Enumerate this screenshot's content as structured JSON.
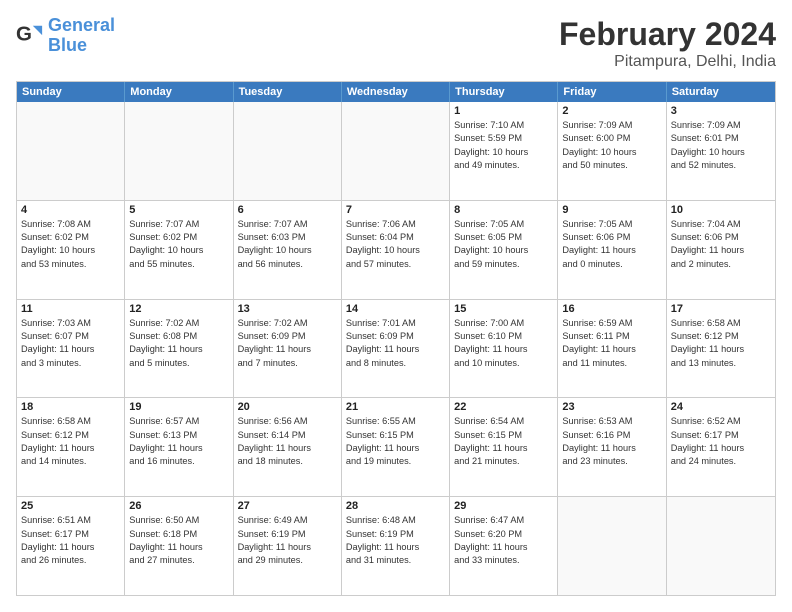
{
  "logo": {
    "text_general": "General",
    "text_blue": "Blue"
  },
  "title": "February 2024",
  "subtitle": "Pitampura, Delhi, India",
  "headers": [
    "Sunday",
    "Monday",
    "Tuesday",
    "Wednesday",
    "Thursday",
    "Friday",
    "Saturday"
  ],
  "rows": [
    [
      {
        "day": "",
        "info": "",
        "empty": true
      },
      {
        "day": "",
        "info": "",
        "empty": true
      },
      {
        "day": "",
        "info": "",
        "empty": true
      },
      {
        "day": "",
        "info": "",
        "empty": true
      },
      {
        "day": "1",
        "info": "Sunrise: 7:10 AM\nSunset: 5:59 PM\nDaylight: 10 hours\nand 49 minutes."
      },
      {
        "day": "2",
        "info": "Sunrise: 7:09 AM\nSunset: 6:00 PM\nDaylight: 10 hours\nand 50 minutes."
      },
      {
        "day": "3",
        "info": "Sunrise: 7:09 AM\nSunset: 6:01 PM\nDaylight: 10 hours\nand 52 minutes."
      }
    ],
    [
      {
        "day": "4",
        "info": "Sunrise: 7:08 AM\nSunset: 6:02 PM\nDaylight: 10 hours\nand 53 minutes."
      },
      {
        "day": "5",
        "info": "Sunrise: 7:07 AM\nSunset: 6:02 PM\nDaylight: 10 hours\nand 55 minutes."
      },
      {
        "day": "6",
        "info": "Sunrise: 7:07 AM\nSunset: 6:03 PM\nDaylight: 10 hours\nand 56 minutes."
      },
      {
        "day": "7",
        "info": "Sunrise: 7:06 AM\nSunset: 6:04 PM\nDaylight: 10 hours\nand 57 minutes."
      },
      {
        "day": "8",
        "info": "Sunrise: 7:05 AM\nSunset: 6:05 PM\nDaylight: 10 hours\nand 59 minutes."
      },
      {
        "day": "9",
        "info": "Sunrise: 7:05 AM\nSunset: 6:06 PM\nDaylight: 11 hours\nand 0 minutes."
      },
      {
        "day": "10",
        "info": "Sunrise: 7:04 AM\nSunset: 6:06 PM\nDaylight: 11 hours\nand 2 minutes."
      }
    ],
    [
      {
        "day": "11",
        "info": "Sunrise: 7:03 AM\nSunset: 6:07 PM\nDaylight: 11 hours\nand 3 minutes."
      },
      {
        "day": "12",
        "info": "Sunrise: 7:02 AM\nSunset: 6:08 PM\nDaylight: 11 hours\nand 5 minutes."
      },
      {
        "day": "13",
        "info": "Sunrise: 7:02 AM\nSunset: 6:09 PM\nDaylight: 11 hours\nand 7 minutes."
      },
      {
        "day": "14",
        "info": "Sunrise: 7:01 AM\nSunset: 6:09 PM\nDaylight: 11 hours\nand 8 minutes."
      },
      {
        "day": "15",
        "info": "Sunrise: 7:00 AM\nSunset: 6:10 PM\nDaylight: 11 hours\nand 10 minutes."
      },
      {
        "day": "16",
        "info": "Sunrise: 6:59 AM\nSunset: 6:11 PM\nDaylight: 11 hours\nand 11 minutes."
      },
      {
        "day": "17",
        "info": "Sunrise: 6:58 AM\nSunset: 6:12 PM\nDaylight: 11 hours\nand 13 minutes."
      }
    ],
    [
      {
        "day": "18",
        "info": "Sunrise: 6:58 AM\nSunset: 6:12 PM\nDaylight: 11 hours\nand 14 minutes."
      },
      {
        "day": "19",
        "info": "Sunrise: 6:57 AM\nSunset: 6:13 PM\nDaylight: 11 hours\nand 16 minutes."
      },
      {
        "day": "20",
        "info": "Sunrise: 6:56 AM\nSunset: 6:14 PM\nDaylight: 11 hours\nand 18 minutes."
      },
      {
        "day": "21",
        "info": "Sunrise: 6:55 AM\nSunset: 6:15 PM\nDaylight: 11 hours\nand 19 minutes."
      },
      {
        "day": "22",
        "info": "Sunrise: 6:54 AM\nSunset: 6:15 PM\nDaylight: 11 hours\nand 21 minutes."
      },
      {
        "day": "23",
        "info": "Sunrise: 6:53 AM\nSunset: 6:16 PM\nDaylight: 11 hours\nand 23 minutes."
      },
      {
        "day": "24",
        "info": "Sunrise: 6:52 AM\nSunset: 6:17 PM\nDaylight: 11 hours\nand 24 minutes."
      }
    ],
    [
      {
        "day": "25",
        "info": "Sunrise: 6:51 AM\nSunset: 6:17 PM\nDaylight: 11 hours\nand 26 minutes."
      },
      {
        "day": "26",
        "info": "Sunrise: 6:50 AM\nSunset: 6:18 PM\nDaylight: 11 hours\nand 27 minutes."
      },
      {
        "day": "27",
        "info": "Sunrise: 6:49 AM\nSunset: 6:19 PM\nDaylight: 11 hours\nand 29 minutes."
      },
      {
        "day": "28",
        "info": "Sunrise: 6:48 AM\nSunset: 6:19 PM\nDaylight: 11 hours\nand 31 minutes."
      },
      {
        "day": "29",
        "info": "Sunrise: 6:47 AM\nSunset: 6:20 PM\nDaylight: 11 hours\nand 33 minutes."
      },
      {
        "day": "",
        "info": "",
        "empty": true
      },
      {
        "day": "",
        "info": "",
        "empty": true
      }
    ]
  ]
}
